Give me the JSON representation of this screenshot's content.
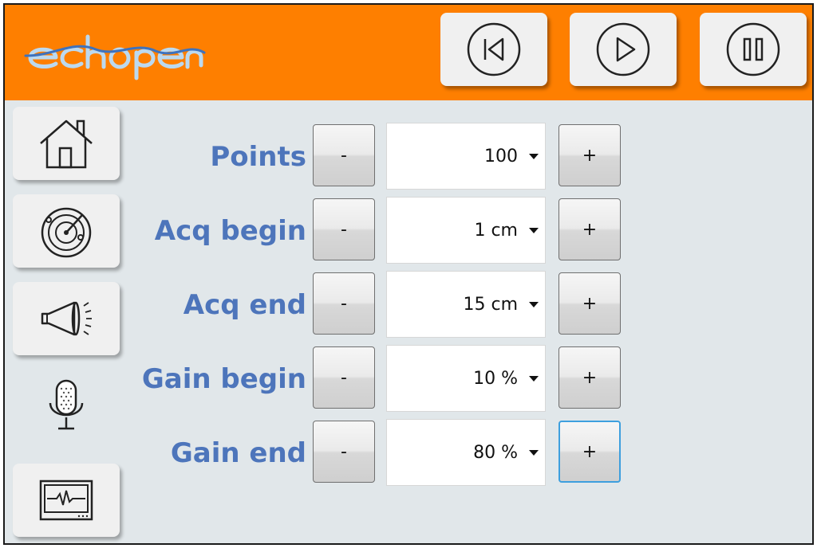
{
  "header": {
    "logo_text": "echopen",
    "brand_color": "#fe7f00",
    "accent_color": "#4d75bb",
    "controls": [
      {
        "name": "skip-back",
        "icon": "skip-back-icon"
      },
      {
        "name": "play",
        "icon": "play-icon"
      },
      {
        "name": "pause",
        "icon": "pause-icon"
      }
    ]
  },
  "sidebar": {
    "items": [
      {
        "icon": "home-icon"
      },
      {
        "icon": "radar-icon"
      },
      {
        "icon": "megaphone-icon"
      },
      {
        "icon": "microphone-icon"
      },
      {
        "icon": "monitor-icon"
      }
    ]
  },
  "settings": {
    "rows": [
      {
        "label": "Points",
        "value": "100",
        "minus": "-",
        "plus": "+"
      },
      {
        "label": "Acq begin",
        "value": "1 cm",
        "minus": "-",
        "plus": "+"
      },
      {
        "label": "Acq end",
        "value": "15 cm",
        "minus": "-",
        "plus": "+"
      },
      {
        "label": "Gain begin",
        "value": "10 %",
        "minus": "-",
        "plus": "+"
      },
      {
        "label": "Gain end",
        "value": "80 %",
        "minus": "-",
        "plus": "+"
      }
    ]
  }
}
